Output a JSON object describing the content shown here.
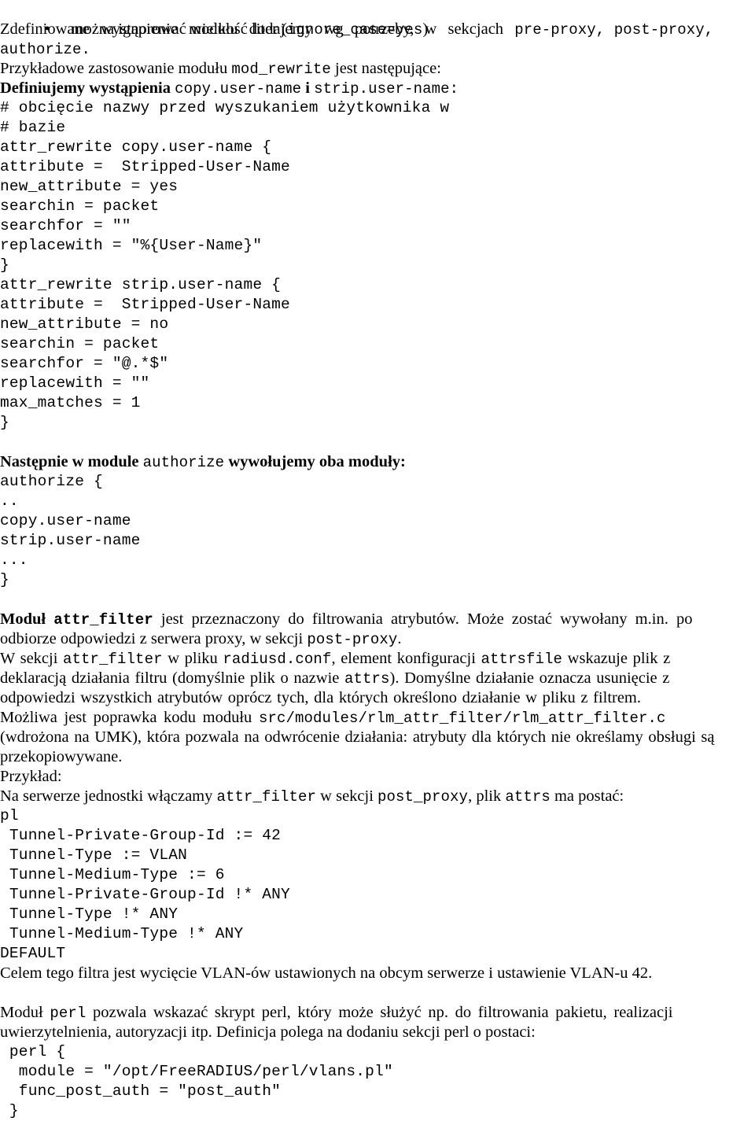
{
  "document": {
    "language": "pl",
    "bullet_glyph": "•",
    "bullet_item": {
      "text_before": "można ignorować wielkość liter (",
      "code": "ignore_case=yes",
      "text_after": ")"
    },
    "para1": {
      "line1_a": "Zdefiniowane wystąpienie modułu dodajemy wg potrzeby, w sekcjach ",
      "line1_code": "pre-proxy, post-proxy,",
      "line2_code": "authorize."
    },
    "para2": {
      "line1_a": "Przykładowe zastosowanie modułu ",
      "line1_code": "mod_rewrite",
      "line1_b": " jest następujące:"
    },
    "para3": {
      "line1_a": "Definiujemy wystąpienia ",
      "line1_code1": "copy.user-name",
      "line1_b": " i ",
      "line1_code2": "strip.user-name:"
    },
    "code_block_1": [
      "# obcięcie nazwy przed wyszukaniem użytkownika w",
      "# bazie",
      "attr_rewrite copy.user-name {",
      "attribute =  Stripped-User-Name",
      "new_attribute = yes",
      "searchin = packet",
      "searchfor = \"\"",
      "replacewith = \"%{User-Name}\"",
      "}",
      "attr_rewrite strip.user-name {",
      "attribute =  Stripped-User-Name",
      "new_attribute = no",
      "searchin = packet",
      "searchfor = \"@.*$\"",
      "replacewith = \"\"",
      "max_matches = 1",
      "}"
    ],
    "para4": {
      "line1_a": "Następnie w module ",
      "line1_code": "authorize",
      "line1_b": " wywołujemy oba moduły:"
    },
    "code_block_2": [
      "authorize {",
      "..",
      "copy.user-name",
      "strip.user-name",
      "...",
      "}"
    ],
    "para5": {
      "l1_bold": "Moduł ",
      "l1_code_bold": "attr_filter",
      "l1_rest": " jest przeznaczony do filtrowania atrybutów. Może zostać wywołany m.in.   po",
      "l2_a": "odbiorze odpowiedzi z serwera proxy, w sekcji ",
      "l2_code": "post-proxy",
      "l2_b": "."
    },
    "para6": {
      "l1_a": "W sekcji ",
      "l1_code1": "attr_filter",
      "l1_b": " w pliku ",
      "l1_code2": "radiusd.conf",
      "l1_c": ", element konfiguracji ",
      "l1_code3": "attrsfile",
      "l1_d": " wskazuje plik z",
      "l2_a": "deklaracją działania filtru (domyślnie plik o nazwie ",
      "l2_code": "attrs",
      "l2_b": ").  Domyślne działanie oznacza usunięcie z",
      "l3": "odpowiedzi wszystkich atrybutów oprócz tych, dla których określono działanie w pliku z filtrem.",
      "l4_a": "Możliwa jest poprawka kodu modułu ",
      "l4_code": "src/modules/rlm_attr_filter/rlm_attr_filter.c",
      "l5": "(wdrożona na UMK), która pozwala na odwrócenie działania: atrybuty dla których nie określamy obsługi są",
      "l6": "przekopiowywane."
    },
    "para7": {
      "label": "Przykład:",
      "l1_a": "Na serwerze jednostki włączamy ",
      "l1_code1": "attr_filter",
      "l1_b": " w sekcji ",
      "l1_code2": "post_proxy",
      "l1_c": ", plik ",
      "l1_code3": "attrs",
      "l1_d": " ma postać:"
    },
    "code_block_3": [
      "pl",
      " Tunnel-Private-Group-Id := 42",
      " Tunnel-Type := VLAN",
      " Tunnel-Medium-Type := 6",
      " Tunnel-Private-Group-Id !* ANY",
      " Tunnel-Type !* ANY",
      " Tunnel-Medium-Type !* ANY",
      "DEFAULT"
    ],
    "para8": {
      "line1": "Celem tego filtra jest wycięcie VLAN-ów ustawionych na obcym serwerze i ustawienie VLAN-u 42."
    },
    "para9": {
      "l1_a": "Moduł ",
      "l1_code": "perl",
      "l1_b": " pozwala wskazać skrypt perl, który może służyć np. do filtrowania pakietu, realizacji",
      "l2": "uwierzytelnienia, autoryzacji itp. Definicja polega na dodaniu sekcji perl o postaci:"
    },
    "code_block_4": [
      " perl {",
      "  module = \"/opt/FreeRADIUS/perl/vlans.pl\"",
      "  func_post_auth = \"post_auth\"",
      " }"
    ]
  }
}
